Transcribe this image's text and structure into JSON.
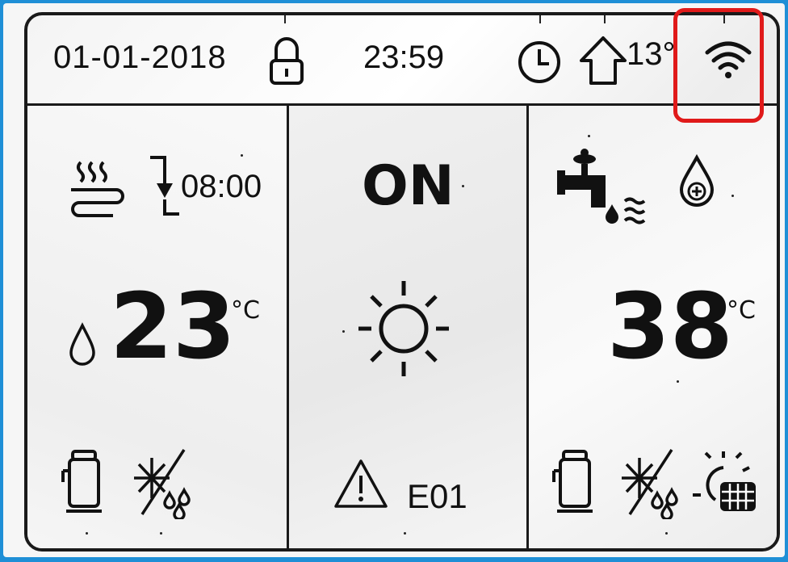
{
  "status_bar": {
    "date": "01-01-2018",
    "time": "23:59",
    "outdoor_temp": "13°",
    "icons": [
      "lock-icon",
      "clock-icon",
      "outdoor-house-icon",
      "wifi-icon"
    ]
  },
  "zone1": {
    "schedule_time": "08:00",
    "temperature": "23",
    "unit": "°C",
    "icons": [
      "floor-heating-icon",
      "schedule-arrow-icon",
      "water-drop-icon",
      "pump-icon",
      "frost-protection-icon"
    ]
  },
  "center": {
    "power_status": "ON",
    "mode_icon": "sun-icon",
    "error_code": "E01",
    "icons": [
      "warning-icon"
    ]
  },
  "dhw": {
    "temperature": "38",
    "unit": "°C",
    "icons": [
      "faucet-icon",
      "drop-plus-icon",
      "pump-icon",
      "frost-protection-icon",
      "solar-panel-icon"
    ]
  },
  "highlight_color": "#e01a1a",
  "frame_color": "#1f8fd6"
}
